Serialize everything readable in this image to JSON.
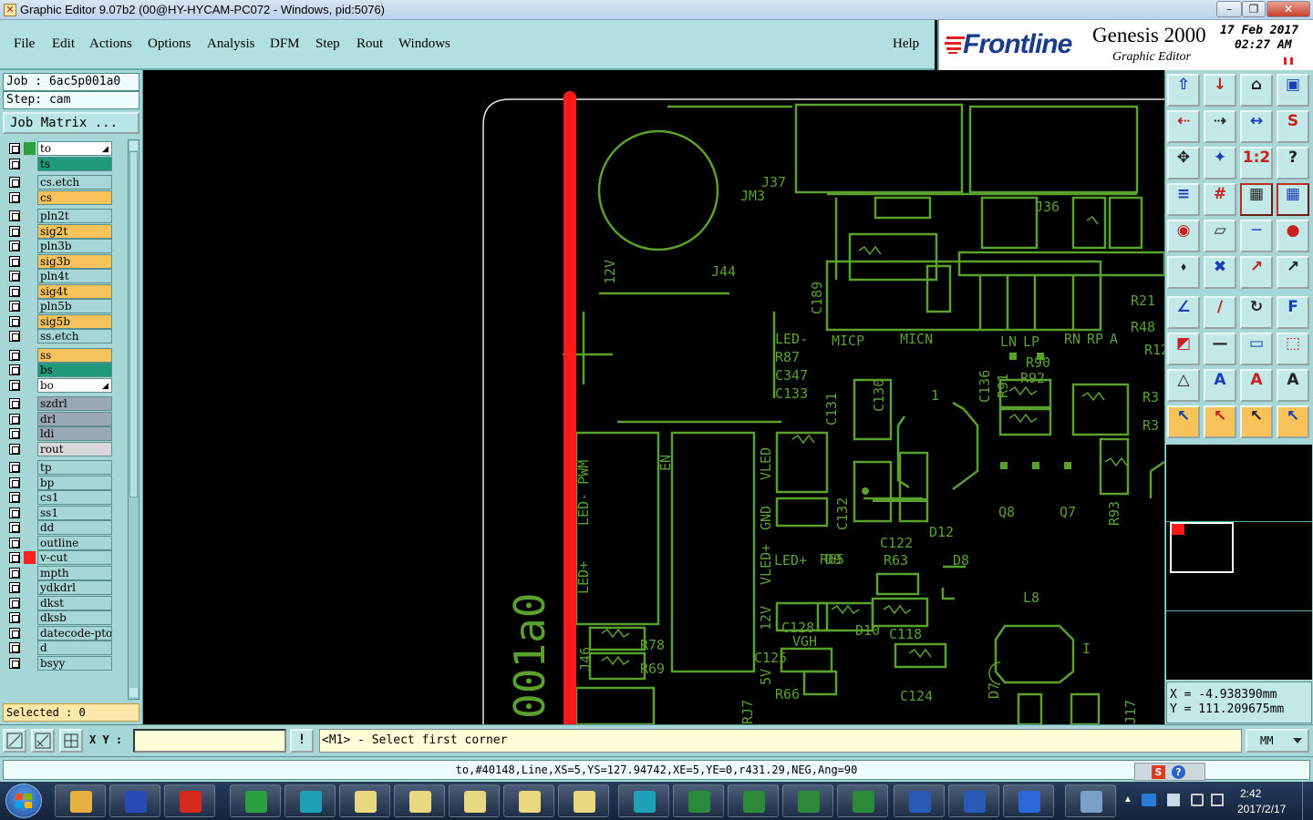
{
  "window": {
    "title": "Graphic Editor 9.07b2 (00@HY-HYCAM-PC072 - Windows, pid:5076)",
    "app_icon_glyph": "✕"
  },
  "menu": {
    "file": "File",
    "edit": "Edit",
    "actions": "Actions",
    "options": "Options",
    "analysis": "Analysis",
    "dfm": "DFM",
    "step": "Step",
    "rout": "Rout",
    "windows": "Windows",
    "help": "Help"
  },
  "brand": {
    "logo": "Frontline",
    "product": "Genesis 2000",
    "subtitle": "Graphic Editor",
    "date": "17 Feb 2017",
    "time": "02:27 AM"
  },
  "job": {
    "job_label": "Job : 6ac5p001a0",
    "step_label": "Step: cam",
    "matrix_button": "Job Matrix ..."
  },
  "layers": [
    {
      "name": "to",
      "bg": "#ffffff",
      "swatch": "#2fa040",
      "arrow": true
    },
    {
      "name": "ts",
      "bg": "#1f9a7a",
      "swatch": "",
      "arrow": false
    },
    {
      "name": "cs.etch",
      "bg": "#a6d6d6",
      "swatch": "",
      "arrow": false
    },
    {
      "name": "cs",
      "bg": "#f7c25a",
      "swatch": "",
      "arrow": false
    },
    {
      "name": "pln2t",
      "bg": "#a6d6d6",
      "swatch": "",
      "arrow": false
    },
    {
      "name": "sig2t",
      "bg": "#f7c25a",
      "swatch": "",
      "arrow": false
    },
    {
      "name": "pln3b",
      "bg": "#a6d6d6",
      "swatch": "",
      "arrow": false
    },
    {
      "name": "sig3b",
      "bg": "#f7c25a",
      "swatch": "",
      "arrow": false
    },
    {
      "name": "pln4t",
      "bg": "#a6d6d6",
      "swatch": "",
      "arrow": false
    },
    {
      "name": "sig4t",
      "bg": "#f7c25a",
      "swatch": "",
      "arrow": false
    },
    {
      "name": "pln5b",
      "bg": "#a6d6d6",
      "swatch": "",
      "arrow": false
    },
    {
      "name": "sig5b",
      "bg": "#f7c25a",
      "swatch": "",
      "arrow": false
    },
    {
      "name": "ss.etch",
      "bg": "#a6d6d6",
      "swatch": "",
      "arrow": false
    },
    {
      "name": "ss",
      "bg": "#f7c25a",
      "swatch": "",
      "arrow": false
    },
    {
      "name": "bs",
      "bg": "#1f9a7a",
      "swatch": "",
      "arrow": false
    },
    {
      "name": "bo",
      "bg": "#ffffff",
      "swatch": "",
      "arrow": true
    },
    {
      "name": "szdrl",
      "bg": "#9aa8b4",
      "swatch": "",
      "arrow": false
    },
    {
      "name": "drl",
      "bg": "#9aa8b4",
      "swatch": "",
      "arrow": false
    },
    {
      "name": "ldi",
      "bg": "#9aa8b4",
      "swatch": "",
      "arrow": false
    },
    {
      "name": "rout",
      "bg": "#d8d8d8",
      "swatch": "",
      "arrow": false
    },
    {
      "name": "tp",
      "bg": "#a6d6d6",
      "swatch": "",
      "arrow": false
    },
    {
      "name": "bp",
      "bg": "#a6d6d6",
      "swatch": "",
      "arrow": false
    },
    {
      "name": "cs1",
      "bg": "#a6d6d6",
      "swatch": "",
      "arrow": false
    },
    {
      "name": "ss1",
      "bg": "#a6d6d6",
      "swatch": "",
      "arrow": false
    },
    {
      "name": "dd",
      "bg": "#a6d6d6",
      "swatch": "",
      "arrow": false
    },
    {
      "name": "outline",
      "bg": "#a6d6d6",
      "swatch": "",
      "arrow": false
    },
    {
      "name": "v-cut",
      "bg": "#a6d6d6",
      "swatch": "#ff2020",
      "arrow": false
    },
    {
      "name": "mpth",
      "bg": "#a6d6d6",
      "swatch": "",
      "arrow": false
    },
    {
      "name": "ydkdrl",
      "bg": "#a6d6d6",
      "swatch": "",
      "arrow": false
    },
    {
      "name": "dkst",
      "bg": "#a6d6d6",
      "swatch": "",
      "arrow": false
    },
    {
      "name": "dksb",
      "bg": "#a6d6d6",
      "swatch": "",
      "arrow": false
    },
    {
      "name": "datecode-pto",
      "bg": "#a6d6d6",
      "swatch": "",
      "arrow": false
    },
    {
      "name": "d",
      "bg": "#a6d6d6",
      "swatch": "",
      "arrow": false
    },
    {
      "name": "bsyy",
      "bg": "#a6d6d6",
      "swatch": "",
      "arrow": false
    }
  ],
  "selected": "Selected : 0",
  "pcb_labels": {
    "j37": "J37",
    "jm3": "JM3",
    "j36": "J36",
    "j44": "J44",
    "v12": "12V",
    "c189": "C189",
    "r21": "R21",
    "r48": "R48",
    "r12": "R12",
    "a": "A",
    "led_minus": "LED-",
    "r87": "R87",
    "c347": "C347",
    "c133": "C133",
    "micp": "MICP",
    "micn": "MICN",
    "ln": "LN",
    "lp": "LP",
    "rn": "RN",
    "rp": "RP",
    "r90": "R90",
    "r92": "R92",
    "r91": "R91",
    "c136": "C136",
    "c130": "C130",
    "c131": "C131",
    "r3a": "R3",
    "r3b": "R3",
    "one": "1",
    "led_pwm": "LED- PWM",
    "en": "EN",
    "led_plus_v": "LED+",
    "vled": "VLED",
    "gnd": "GND",
    "vled_plus": "VLED+",
    "c132": "C132",
    "d9": "D9",
    "led_plus": "LED+",
    "r65": "R65",
    "d12": "D12",
    "c122": "C122",
    "r63": "R63",
    "d8": "D8",
    "q8": "Q8",
    "q7": "Q7",
    "r93": "R93",
    "l8": "L8",
    "v12b": "12V",
    "c128": "C128",
    "vgh": "VGH",
    "d10": "D10",
    "c118": "C118",
    "c125": "C125",
    "v5": "5V",
    "r66": "R66",
    "c124": "C124",
    "d7": "D7",
    "t": "I",
    "r78": "R78",
    "r69": "R69",
    "j46": "J46",
    "rj7": "RJ7",
    "j17": "J17",
    "big_text": "001a0"
  },
  "coords": {
    "x": "X = -4.938390mm",
    "y": "Y = 111.209675mm"
  },
  "bottom": {
    "xy_label": "X Y :",
    "xy_value": "",
    "prompt": "<M1> - Select first corner",
    "units": "MM",
    "excl": "!"
  },
  "status": "to,#40148,Line,XS=5,YS=127.94742,XE=5,YE=0,r431.29,NEG,Ang=90",
  "taskbar": {
    "time": "2:42",
    "date": "2017/2/17",
    "start": "start-button"
  },
  "colors": {
    "pcb_green": "#5aa02c",
    "vcut_red": "#ff1a1a",
    "panel": "#a6d6d6",
    "accent_orange": "#f7c25a"
  }
}
